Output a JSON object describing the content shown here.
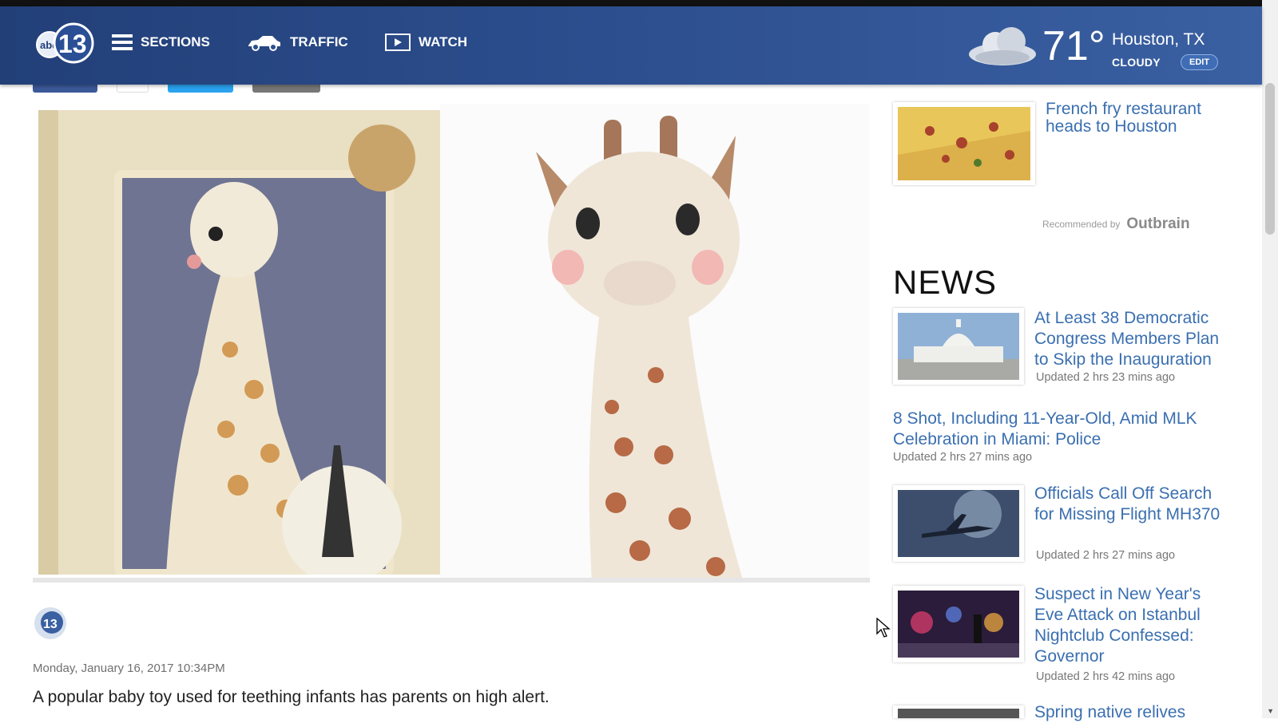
{
  "header": {
    "logo_text": "abc13",
    "nav": [
      {
        "label": "SECTIONS",
        "icon": "hamburger-icon"
      },
      {
        "label": "TRAFFIC",
        "icon": "car-icon"
      },
      {
        "label": "WATCH",
        "icon": "play-icon"
      }
    ],
    "weather": {
      "temp": "71°",
      "city": "Houston, TX",
      "condition": "CLOUDY",
      "edit_label": "EDIT"
    }
  },
  "share": [
    "facebook",
    "pinterest",
    "twitter",
    "email"
  ],
  "article": {
    "dateline": "Monday, January 16, 2017 10:34PM",
    "lead": "A popular baby toy used for teething infants has parents on high alert."
  },
  "recommended": {
    "title": "French fry restaurant heads to Houston",
    "by_label": "Recommended by",
    "brand": "Outbrain"
  },
  "news": {
    "heading": "NEWS",
    "items": [
      {
        "title": "At Least 38 Democratic Congress Members Plan to Skip the Inauguration",
        "updated": "Updated 2 hrs 23 mins ago"
      },
      {
        "title": "8 Shot, Including 11-Year-Old, Amid MLK Celebration in Miami: Police",
        "updated": "Updated 2 hrs 27 mins ago"
      },
      {
        "title": "Officials Call Off Search for Missing Flight MH370",
        "updated": "Updated 2 hrs 27 mins ago"
      },
      {
        "title": "Suspect in New Year's Eve Attack on Istanbul Nightclub Confessed: Governor",
        "updated": "Updated 2 hrs 42 mins ago"
      },
      {
        "title": "Spring native relives",
        "updated": ""
      }
    ]
  },
  "colors": {
    "header": "#2d4f8f",
    "link": "#3a6fb0"
  }
}
